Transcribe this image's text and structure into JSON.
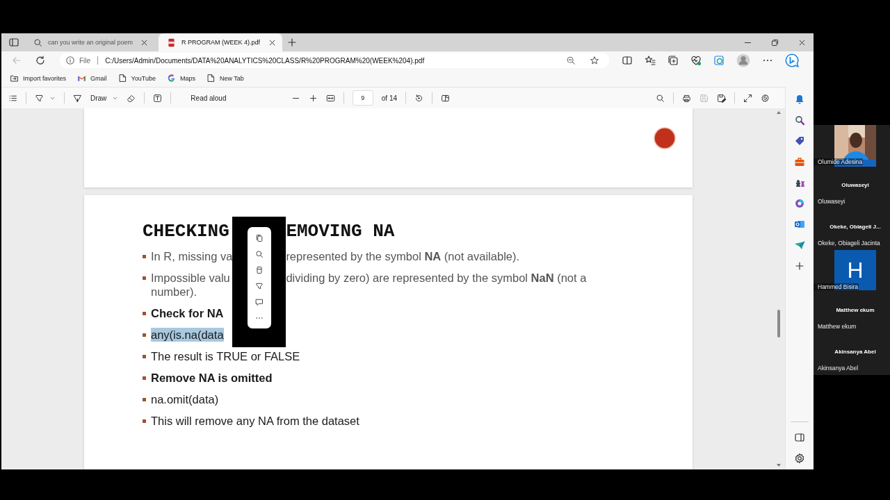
{
  "browser": {
    "tabs": [
      {
        "title": "can you write an original poem",
        "kind": "search",
        "selected": false
      },
      {
        "title": "R PROGRAM (WEEK 4).pdf",
        "kind": "pdf",
        "selected": true
      }
    ],
    "address": {
      "scheme": "File",
      "url": "C:/Users/Admin/Documents/DATA%20ANALYTICS%20CLASS/R%20PROGRAM%20(WEEK%204).pdf"
    },
    "bookmarks": [
      {
        "label": "Import favorites",
        "kind": "import"
      },
      {
        "label": "Gmail",
        "kind": "gmail"
      },
      {
        "label": "YouTube",
        "kind": "page"
      },
      {
        "label": "Maps",
        "kind": "google"
      },
      {
        "label": "New Tab",
        "kind": "page"
      }
    ]
  },
  "pdf_toolbar": {
    "draw": "Draw",
    "read_aloud": "Read aloud",
    "page": "9",
    "page_count": "of 14"
  },
  "slide": {
    "title_parts": [
      "CHECKING",
      "EMOVING NA"
    ],
    "bullets": [
      {
        "parts": [
          "In R, missing va",
          "represented by the symbol **NA** (not available)."
        ],
        "bold": false,
        "muted": true,
        "selected": false
      },
      {
        "parts": [
          "Impossible valu",
          "dividing by zero) are represented by the symbol **NaN** (not a"
        ],
        "continuation": "number).",
        "bold": false,
        "muted": true,
        "selected": false
      },
      {
        "parts": [
          "Check for NA"
        ],
        "bold": true,
        "muted": false,
        "selected": false
      },
      {
        "parts": [
          "any(is.na(data"
        ],
        "bold": false,
        "muted": false,
        "selected": true
      },
      {
        "parts": [
          "The result is TRUE or FALSE"
        ],
        "bold": false,
        "muted": false,
        "selected": false
      },
      {
        "parts": [
          "Remove NA is omitted"
        ],
        "bold": true,
        "muted": false,
        "selected": false
      },
      {
        "parts": [
          "na.omit(data)"
        ],
        "bold": false,
        "muted": false,
        "selected": false
      },
      {
        "parts": [
          "This will remove any NA from the dataset"
        ],
        "bold": false,
        "muted": false,
        "selected": false
      }
    ]
  },
  "participants": [
    {
      "name": "Olumide Adesina"
    },
    {
      "name": "Oluwaseyi",
      "caption": "Oluwaseyi",
      "kind": "blank"
    },
    {
      "name": "Okeke, Obiageli Jacinta",
      "caption": "Okeke, Obiageli J...",
      "kind": "blank"
    },
    {
      "name": "Hammed Bisira",
      "initial": "H",
      "kind": "initial"
    },
    {
      "name": "Matthew ekum",
      "caption": "Matthew ekum",
      "kind": "blank"
    },
    {
      "name": "Akinsanya Abel",
      "caption": "Akinsanya Abel",
      "kind": "blank"
    }
  ]
}
